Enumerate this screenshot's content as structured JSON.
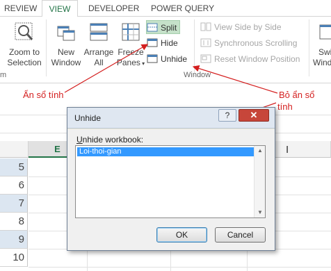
{
  "tabs": {
    "review": "REVIEW",
    "view": "VIEW",
    "developer": "DEVELOPER",
    "power_query": "POWER QUERY"
  },
  "ribbon": {
    "zoom_label_1": "Zoom to",
    "zoom_label_2": "Selection",
    "new_window_1": "New",
    "new_window_2": "Window",
    "arrange_1": "Arrange",
    "arrange_2": "All",
    "freeze_1": "Freeze",
    "freeze_2": "Panes",
    "split": "Split",
    "hide": "Hide",
    "unhide": "Unhide",
    "view_side_by_side": "View Side by Side",
    "sync_scrolling": "Synchronous Scrolling",
    "reset_window_position": "Reset Window Position",
    "switch_1": "Swi",
    "switch_2": "Windo",
    "group_zoom_partial": "m",
    "group_window": "Window"
  },
  "annotations": {
    "hide_note": "Ẩn sổ tính",
    "unhide_note_1": "Bỏ ẩn sổ",
    "unhide_note_2": "tính"
  },
  "sheet": {
    "column_e": "E",
    "rows": [
      "5",
      "6",
      "7",
      "8",
      "9",
      "10"
    ]
  },
  "dialog": {
    "title": "Unhide",
    "help": "?",
    "close": "✕",
    "label_accel": "U",
    "label_rest": "nhide workbook:",
    "workbooks": [
      "Loi-thoi-gian"
    ],
    "ok": "OK",
    "cancel": "Cancel"
  },
  "colors": {
    "accent": "#217346",
    "annotation_red": "#d41f1f",
    "selection_blue": "#3399ff"
  }
}
